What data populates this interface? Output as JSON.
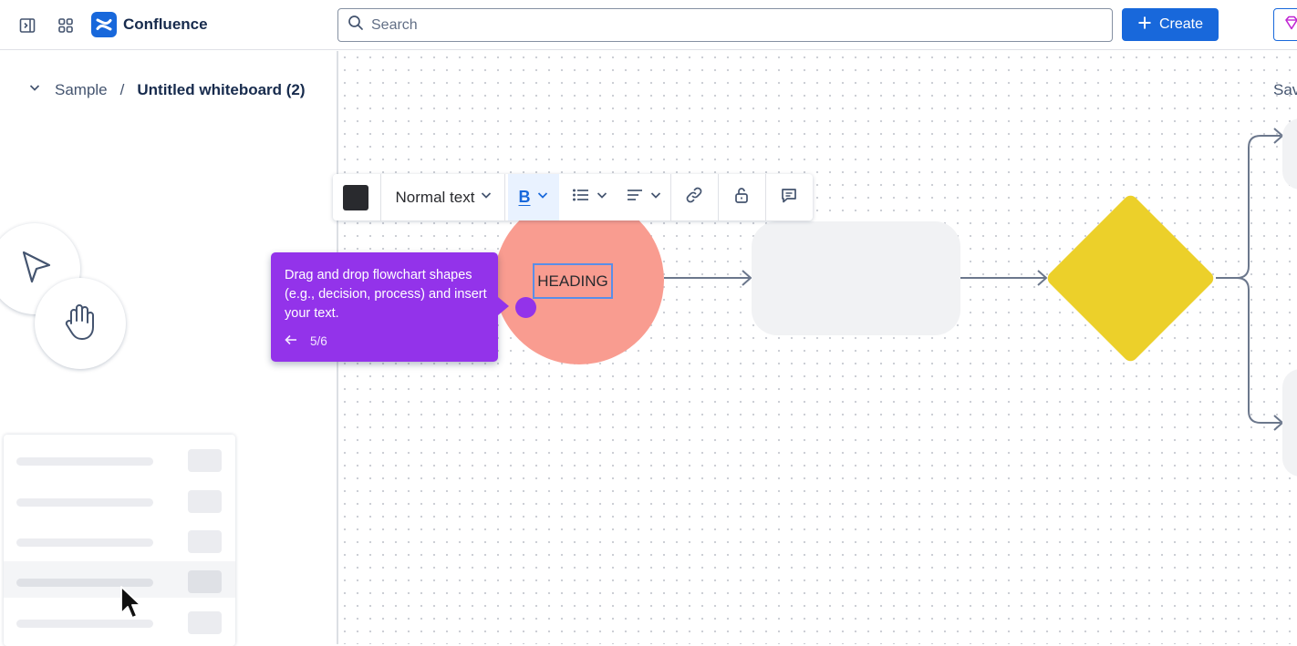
{
  "topbar": {
    "brand": "Confluence",
    "search_placeholder": "Search",
    "create_label": "Create"
  },
  "breadcrumb": {
    "parent": "Sample",
    "separator": "/",
    "current": "Untitled whiteboard (2)"
  },
  "save_status": "Sav",
  "toolbar": {
    "text_style": "Normal text",
    "bold_label": "B",
    "text_color": "#292a2e"
  },
  "tooltip": {
    "body": "Drag and drop flowchart shapes (e.g., decision, process) and insert your text.",
    "step": "5/6"
  },
  "canvas": {
    "heading_text": "HEADING"
  },
  "colors": {
    "accent": "#1868db",
    "tooltip": "#9333ea",
    "circle_shape": "#f99c90",
    "decision_shape": "#ecd02a",
    "process_shape": "#f1f2f4"
  },
  "icons": [
    "sidebar-toggle-icon",
    "app-switcher-icon",
    "confluence-logo-icon",
    "search-icon",
    "plus-icon",
    "premium-gem-icon",
    "chevron-down-icon",
    "select-arrow-icon",
    "hand-pan-icon",
    "bullet-list-icon",
    "align-icon",
    "link-icon",
    "unlock-icon",
    "comment-icon",
    "arrow-left-icon",
    "mouse-cursor-icon"
  ]
}
